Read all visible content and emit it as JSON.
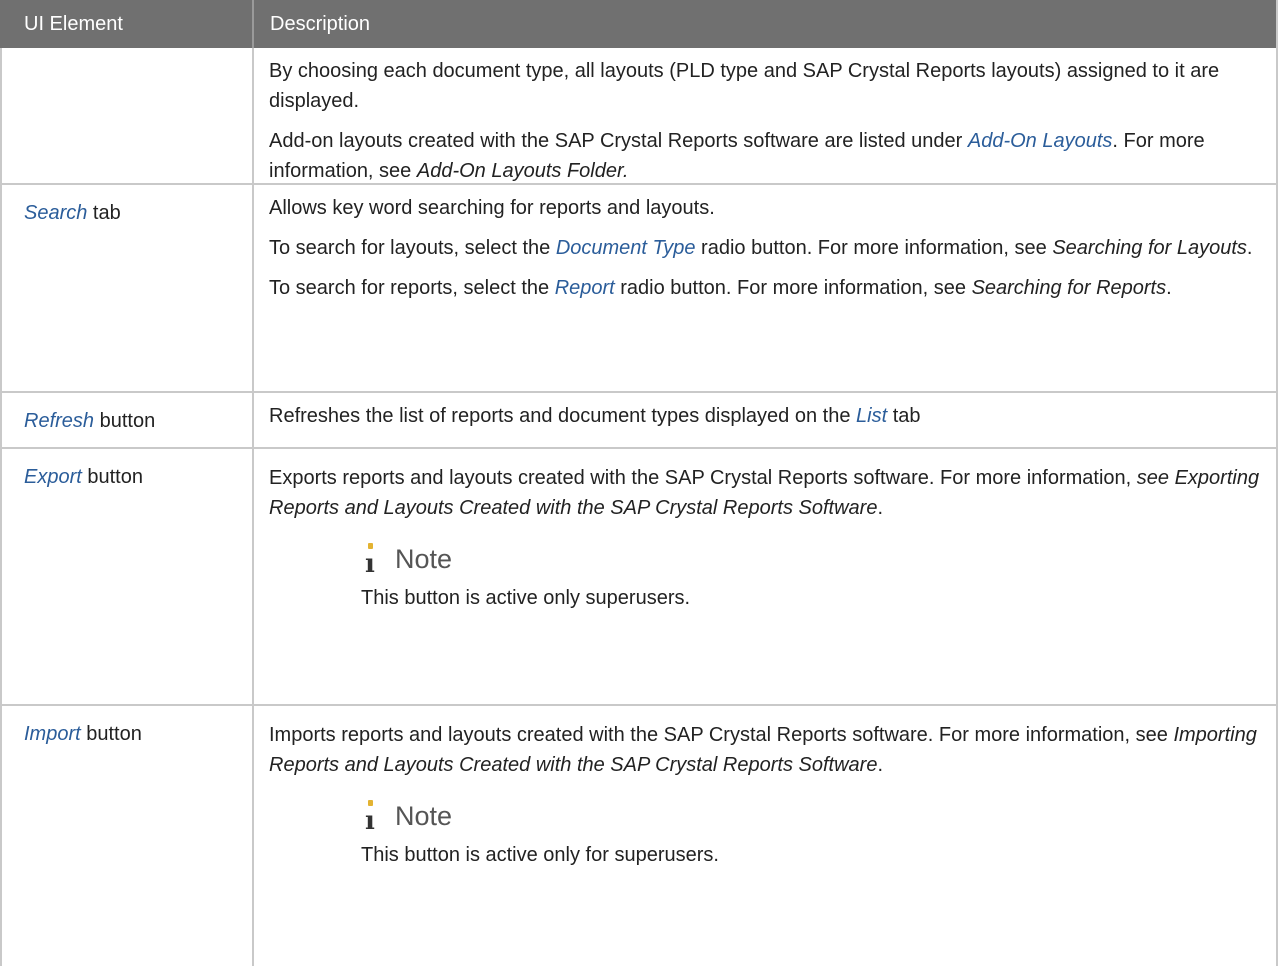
{
  "header": {
    "col1": "UI Element",
    "col2": "Description"
  },
  "rows": {
    "r0": {
      "p1": "By choosing each document type, all layouts (PLD type and SAP Crystal Reports layouts) assigned to it are displayed.",
      "p2a": "Add-on layouts created with the SAP Crystal Reports software are listed under ",
      "p2b": "Add-On Layouts",
      "p2c": ". For more information, see ",
      "p2d": "Add-On Layouts Folder."
    },
    "r1": {
      "el_link": "Search",
      "el_suffix": " tab",
      "p1": "Allows key word searching for reports and layouts.",
      "p2a": "To search for layouts, select the ",
      "p2b": "Document Type",
      "p2c": " radio button. For more information, see ",
      "p2d": "Searching for Layouts",
      "p2e": ".",
      "p3a": "To search for reports, select the ",
      "p3b": "Report",
      "p3c": " radio button. For more information, see ",
      "p3d": "Searching for Reports",
      "p3e": "."
    },
    "r2": {
      "el_link": "Refresh",
      "el_suffix": " button",
      "p1a": "Refreshes the list of reports and document types displayed on the ",
      "p1b": "List",
      "p1c": " tab"
    },
    "r3": {
      "el_link": "Export",
      "el_suffix": " button",
      "p1a": "Exports reports and layouts created with the SAP Crystal Reports software. For more information, ",
      "p1b": "see Exporting Reports and Layouts Created with the SAP Crystal Reports Software",
      "p1c": ".",
      "note_title": "Note",
      "note_text": "This button is active only superusers."
    },
    "r4": {
      "el_link": "Import",
      "el_suffix": " button",
      "p1a": "Imports reports and layouts created with the SAP Crystal Reports software. For more information, see ",
      "p1b": "Importing Reports and Layouts Created with the SAP Crystal Reports Software",
      "p1c": ".",
      "note_title": "Note",
      "note_text": "This button is active only for superusers."
    }
  },
  "icons": {
    "note": "info-i-icon"
  },
  "colors": {
    "header_bg": "#707070",
    "link": "#2b5d9a",
    "note_dot": "#e3b332",
    "border": "#c9c9c9"
  }
}
